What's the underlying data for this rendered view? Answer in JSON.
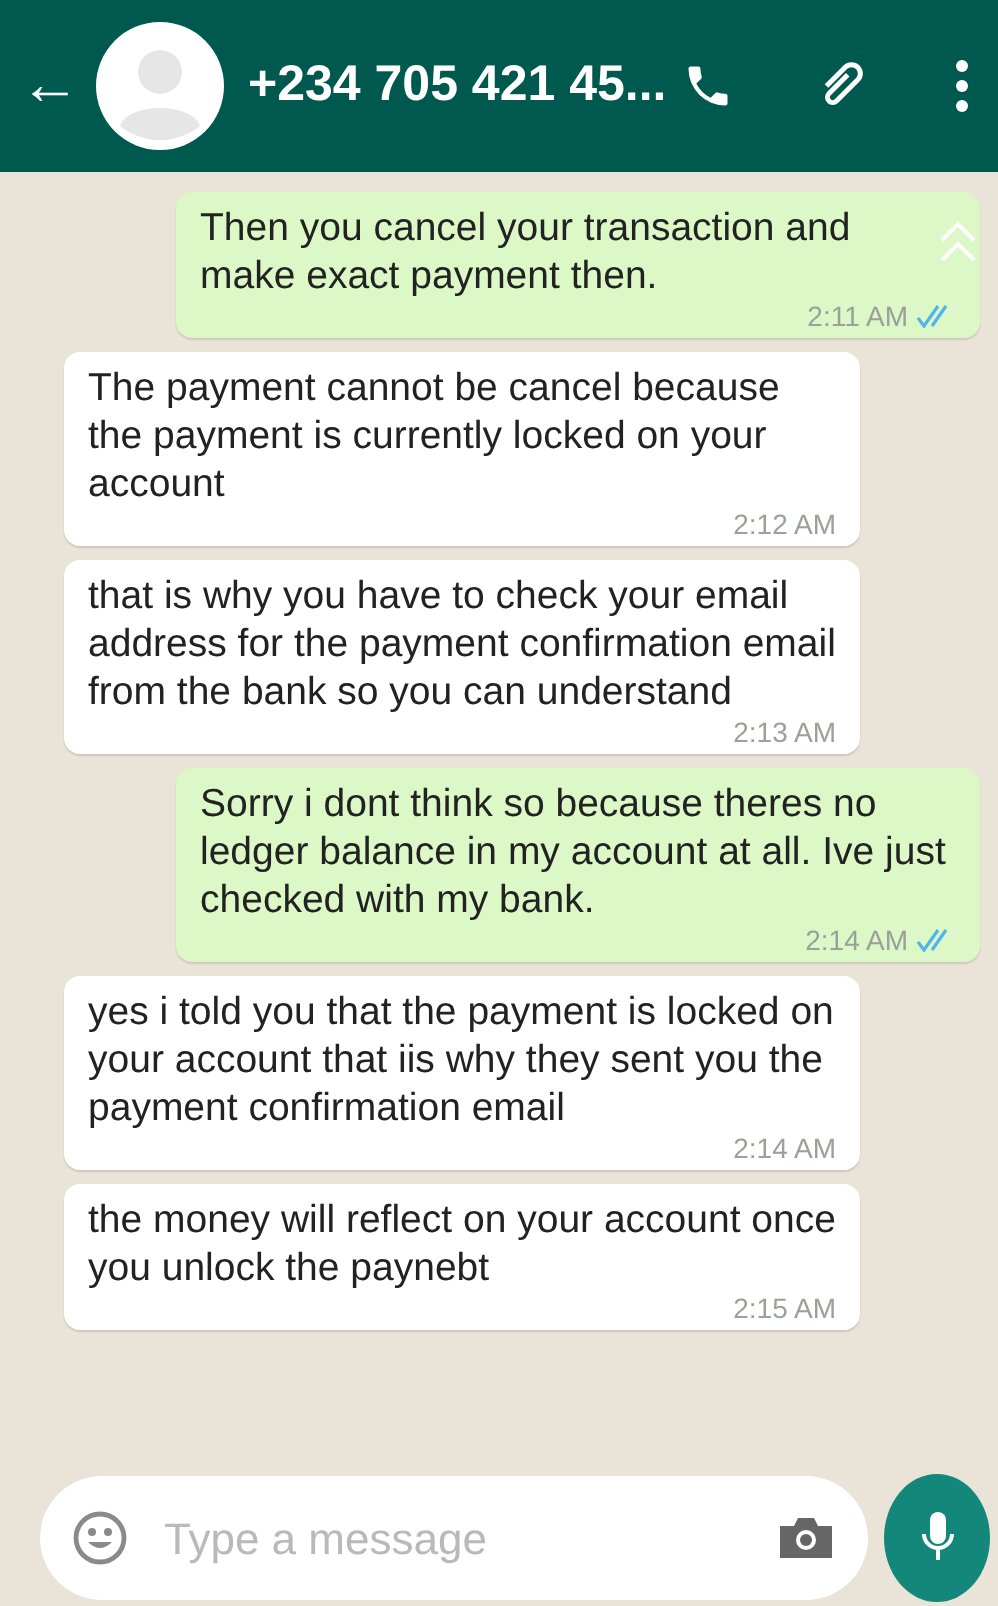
{
  "header": {
    "back": "←",
    "title": "+234 705 421 45..."
  },
  "messages": [
    {
      "kind": "outgoing",
      "text": "Then you cancel your transaction and make exact payment then.",
      "time": "2:11 AM",
      "read": true
    },
    {
      "kind": "incoming",
      "text": "The payment cannot be cancel because the payment is currently locked on your account",
      "time": "2:12 AM"
    },
    {
      "kind": "incoming",
      "text": "that is why you have to check your email address for the payment confirmation email from the bank so you can understand",
      "time": "2:13 AM"
    },
    {
      "kind": "outgoing",
      "text": "Sorry i dont think so because theres no ledger balance in my account at all. Ive just checked with my bank.",
      "time": "2:14 AM",
      "read": true
    },
    {
      "kind": "incoming",
      "text": "yes i told you that the payment is locked on your account that iis why they sent you the payment confirmation email",
      "time": "2:14 AM"
    },
    {
      "kind": "incoming",
      "text": "the money will reflect on your account once you unlock the paynebt",
      "time": "2:15 AM"
    }
  ],
  "composer": {
    "placeholder": "Type a message"
  }
}
